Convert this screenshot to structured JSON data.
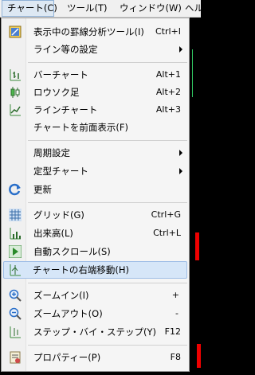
{
  "menubar": {
    "items": [
      "チャート(C)",
      "ツール(T)",
      "ウィンドウ(W)",
      "ヘル"
    ]
  },
  "menu": {
    "items": [
      {
        "label": "表示中の罫線分析ツール(I)",
        "shortcut": "Ctrl+I",
        "icon": "line-tools-icon"
      },
      {
        "label": "ライン等の設定",
        "submenu": true
      },
      {
        "label": "バーチャート",
        "shortcut": "Alt+1",
        "icon": "bar-chart-icon"
      },
      {
        "label": "ロウソク足",
        "shortcut": "Alt+2",
        "icon": "candlestick-icon"
      },
      {
        "label": "ラインチャート",
        "shortcut": "Alt+3",
        "icon": "line-chart-icon"
      },
      {
        "label": "チャートを前面表示(F)"
      },
      {
        "label": "周期設定",
        "submenu": true
      },
      {
        "label": "定型チャート",
        "submenu": true
      },
      {
        "label": "更新",
        "icon": "refresh-icon"
      },
      {
        "label": "グリッド(G)",
        "shortcut": "Ctrl+G",
        "icon": "grid-icon"
      },
      {
        "label": "出来高(L)",
        "shortcut": "Ctrl+L",
        "icon": "volume-icon"
      },
      {
        "label": "自動スクロール(S)",
        "icon": "auto-scroll-icon"
      },
      {
        "label": "チャートの右端移動(H)",
        "icon": "chart-shift-icon",
        "highlighted": true
      },
      {
        "label": "ズームイン(I)",
        "shortcut": "+",
        "icon": "zoom-in-icon"
      },
      {
        "label": "ズームアウト(O)",
        "shortcut": "-",
        "icon": "zoom-out-icon"
      },
      {
        "label": "ステップ・バイ・ステップ(Y)",
        "shortcut": "F12",
        "icon": "step-icon"
      },
      {
        "label": "プロパティー(P)",
        "shortcut": "F8",
        "icon": "properties-icon"
      }
    ]
  },
  "colors": {
    "highlight": "#d6e6f8",
    "accent": "#2a6fc9",
    "chart_red": "#e00000"
  }
}
